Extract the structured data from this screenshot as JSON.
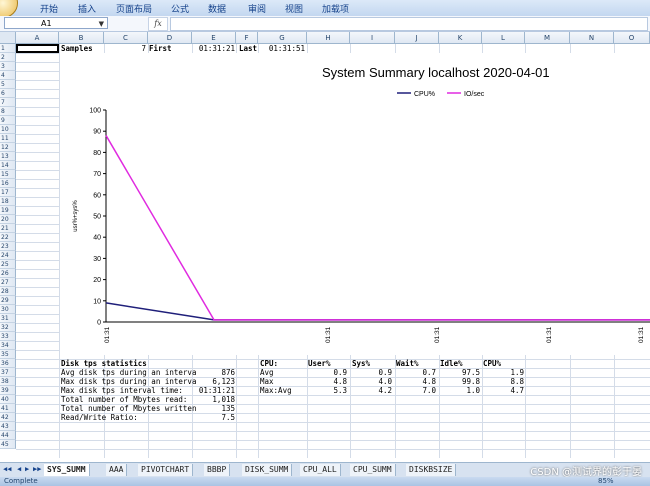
{
  "ribbon": {
    "menu": [
      "开始",
      "插入",
      "页面布局",
      "公式",
      "数据",
      "审阅",
      "视图",
      "加载项"
    ]
  },
  "formula_bar": {
    "namebox": "A1",
    "fx": "fx",
    "value": ""
  },
  "columns": [
    "A",
    "B",
    "C",
    "D",
    "E",
    "F",
    "G",
    "H",
    "I",
    "J",
    "K",
    "L",
    "M",
    "N",
    "O"
  ],
  "rows": [
    "1",
    "2",
    "3",
    "4",
    "5",
    "6",
    "7",
    "8",
    "9",
    "10",
    "11",
    "12",
    "13",
    "14",
    "15",
    "16",
    "17",
    "18",
    "19",
    "20",
    "21",
    "22",
    "23",
    "24",
    "25",
    "26",
    "27",
    "28",
    "29",
    "30",
    "31",
    "32",
    "33",
    "34",
    "35",
    "36",
    "37",
    "38",
    "39",
    "40",
    "41",
    "42",
    "43",
    "44",
    "45"
  ],
  "row1": {
    "samples_label": "Samples",
    "samples_value": "7",
    "first_label": "First",
    "first_value": "01:31:21",
    "last_label": "Last",
    "last_value": "01:31:51"
  },
  "disk": {
    "header": "Disk tps statistics",
    "rows": [
      {
        "label": "Avg disk tps during an interva",
        "value": "876"
      },
      {
        "label": "Max disk tps during an interva",
        "value": "6,123"
      },
      {
        "label": "Max disk tps interval time:",
        "value": "01:31:21"
      },
      {
        "label": "Total number of Mbytes read:",
        "value": "1,018"
      },
      {
        "label": "Total number of Mbytes written",
        "value": "135"
      },
      {
        "label": "Read/Write Ratio:",
        "value": "7.5"
      }
    ]
  },
  "cpu_table": {
    "headers": [
      "CPU:",
      "User%",
      "Sys%",
      "Wait%",
      "Idle%",
      "CPU%"
    ],
    "rows": [
      {
        "label": "Avg",
        "values": [
          "0.9",
          "0.9",
          "0.7",
          "97.5",
          "1.9"
        ]
      },
      {
        "label": "Max",
        "values": [
          "4.8",
          "4.0",
          "4.8",
          "99.8",
          "8.8"
        ]
      },
      {
        "label": "Max:Avg",
        "values": [
          "5.3",
          "4.2",
          "7.0",
          "1.0",
          "4.7"
        ]
      }
    ]
  },
  "chart_data": {
    "type": "line",
    "title": "System Summary  localhost  2020-04-01",
    "ylabel": "usr%+sys%",
    "ylim": [
      0,
      100
    ],
    "yticks": [
      "0",
      "10",
      "20",
      "30",
      "40",
      "50",
      "60",
      "70",
      "80",
      "90",
      "100"
    ],
    "xticks": [
      "01:31",
      "01:31",
      "01:31",
      "01:31",
      "01:31"
    ],
    "legend_position": "top-right",
    "series": [
      {
        "name": "CPU%",
        "color": "#1f1f7a",
        "values": [
          9,
          1,
          1,
          1,
          1,
          1,
          1
        ]
      },
      {
        "name": "IO/sec",
        "color": "#e02be0",
        "values": [
          88,
          1,
          1,
          1,
          1,
          1,
          1
        ]
      }
    ]
  },
  "sheet_tabs": [
    "SYS_SUMM",
    "AAA",
    "PIVOTCHART",
    "BBBP",
    "DISK_SUMM",
    "CPU_ALL",
    "CPU_SUMM",
    "DISKBSIZE"
  ],
  "active_tab": 0,
  "status": {
    "left": "Complete",
    "zoom": "85%"
  },
  "watermark": "CSDN @测试界的彭于晏"
}
